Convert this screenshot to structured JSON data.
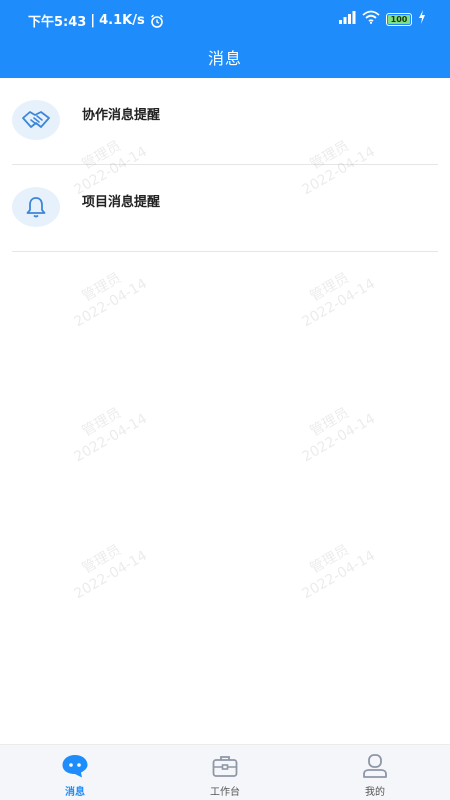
{
  "status_bar": {
    "time": "下午5:43",
    "separator": "|",
    "network_speed": "4.1K/s",
    "battery_level": "100",
    "icons": [
      "alarm-icon",
      "signal-icon",
      "wifi-icon",
      "battery-icon",
      "charging-icon"
    ]
  },
  "header": {
    "title": "消息"
  },
  "messages": {
    "items": [
      {
        "label": "协作消息提醒",
        "icon": "handshake-icon"
      },
      {
        "label": "项目消息提醒",
        "icon": "bell-icon"
      }
    ]
  },
  "watermark": {
    "user": "管理员",
    "date": "2022-04-14"
  },
  "tabbar": {
    "tabs": [
      {
        "label": "消息",
        "icon": "chat-bubble-icon",
        "active": true
      },
      {
        "label": "工作台",
        "icon": "toolbox-icon",
        "active": false
      },
      {
        "label": "我的",
        "icon": "user-icon",
        "active": false
      }
    ]
  },
  "colors": {
    "primary": "#1e8dfb",
    "icon_bg": "#e7f1fc",
    "tab_inactive": "#8e97a8"
  }
}
